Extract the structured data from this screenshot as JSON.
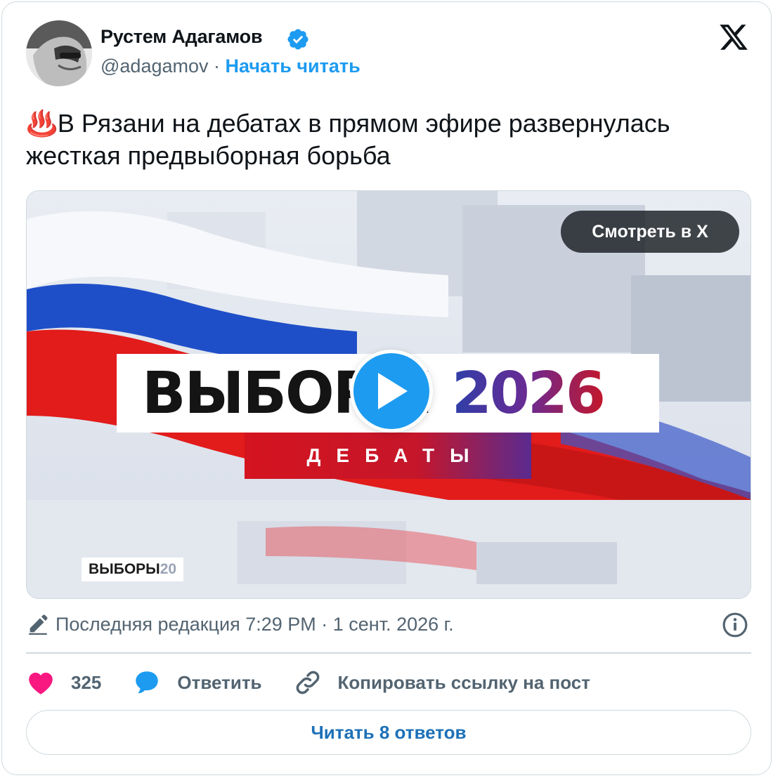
{
  "author": {
    "name": "Рустем Адагамов",
    "handle": "@adagamov",
    "separator": " · ",
    "follow_label": "Начать читать",
    "verified": true
  },
  "tweet": {
    "emoji": "♨️",
    "text": "В Рязани на дебатах в прямом эфире развернулась жесткая предвыборная борьба"
  },
  "media": {
    "watch_label": "Смотреть в X",
    "banner_title": "ВЫБОРЫ",
    "banner_year": "2026",
    "banner_subtitle": "ДЕБАТЫ",
    "corner_label": "ВЫБОРЫ",
    "corner_year": "20"
  },
  "meta": {
    "edited_text": "Последняя редакция 7:29 PM · 1 сент. 2026 г."
  },
  "actions": {
    "likes_count": "325",
    "reply_label": "Ответить",
    "copy_link_label": "Копировать ссылку на пост"
  },
  "replies_button": "Читать 8 ответов",
  "colors": {
    "accent": "#1d9bf0",
    "like": "#f91880",
    "muted": "#536471"
  }
}
